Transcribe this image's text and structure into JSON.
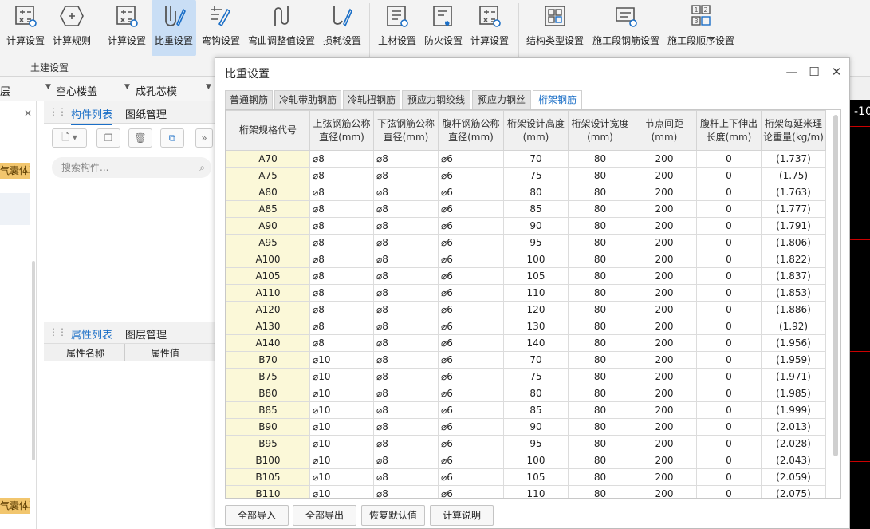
{
  "ribbon": {
    "groups": [
      {
        "label": "土建设置",
        "buttons": [
          {
            "label": "计算设置",
            "icon": "calc-settings-icon"
          },
          {
            "label": "计算规则",
            "icon": "calc-rules-icon"
          }
        ]
      },
      {
        "label": "",
        "buttons": [
          {
            "label": "计算设置",
            "icon": "calc-settings-icon"
          },
          {
            "label": "比重设置",
            "icon": "density-settings-icon",
            "active": true
          },
          {
            "label": "弯钩设置",
            "icon": "hook-settings-icon"
          },
          {
            "label": "弯曲调整值设置",
            "icon": "bend-adjust-icon"
          },
          {
            "label": "损耗设置",
            "icon": "loss-settings-icon"
          }
        ]
      },
      {
        "label": "",
        "buttons": [
          {
            "label": "主材设置",
            "icon": "main-material-icon"
          },
          {
            "label": "防火设置",
            "icon": "fireproof-icon"
          },
          {
            "label": "计算设置",
            "icon": "calc-settings-icon"
          }
        ]
      },
      {
        "label": "",
        "buttons": [
          {
            "label": "结构类型设置",
            "icon": "structure-type-icon"
          },
          {
            "label": "施工段钢筋设置",
            "icon": "segment-rebar-icon"
          },
          {
            "label": "施工段顺序设置",
            "icon": "segment-order-icon"
          }
        ]
      }
    ]
  },
  "filters": {
    "floor_partial": "层",
    "component_type": "空心楼盖",
    "component": "成孔芯模"
  },
  "left_panel": {
    "promo_label": "气囊体验",
    "close_glyph": "✕"
  },
  "component_panel": {
    "tab_list": "构件列表",
    "tab_drawings": "图纸管理",
    "search_placeholder": "搜索构件..."
  },
  "property_panel": {
    "tab_props": "属性列表",
    "tab_layers": "图层管理",
    "col_name": "属性名称",
    "col_value": "属性值"
  },
  "dialog": {
    "title": "比重设置",
    "tabs": [
      "普通钢筋",
      "冷轧带肋钢筋",
      "冷轧扭钢筋",
      "预应力钢绞线",
      "预应力钢丝",
      "桁架钢筋"
    ],
    "active_tab": 5,
    "columns": [
      "桁架规格代号",
      "上弦钢筋公称直径(mm)",
      "下弦钢筋公称直径(mm)",
      "腹杆钢筋公称直径(mm)",
      "桁架设计高度(mm)",
      "桁架设计宽度(mm)",
      "节点间距(mm)",
      "腹杆上下伸出长度(mm)",
      "桁架每延米理论重量(kg/m)"
    ],
    "rows": [
      [
        "A70",
        "⌀8",
        "⌀8",
        "⌀6",
        "70",
        "80",
        "200",
        "0",
        "(1.737)"
      ],
      [
        "A75",
        "⌀8",
        "⌀8",
        "⌀6",
        "75",
        "80",
        "200",
        "0",
        "(1.75)"
      ],
      [
        "A80",
        "⌀8",
        "⌀8",
        "⌀6",
        "80",
        "80",
        "200",
        "0",
        "(1.763)"
      ],
      [
        "A85",
        "⌀8",
        "⌀8",
        "⌀6",
        "85",
        "80",
        "200",
        "0",
        "(1.777)"
      ],
      [
        "A90",
        "⌀8",
        "⌀8",
        "⌀6",
        "90",
        "80",
        "200",
        "0",
        "(1.791)"
      ],
      [
        "A95",
        "⌀8",
        "⌀8",
        "⌀6",
        "95",
        "80",
        "200",
        "0",
        "(1.806)"
      ],
      [
        "A100",
        "⌀8",
        "⌀8",
        "⌀6",
        "100",
        "80",
        "200",
        "0",
        "(1.822)"
      ],
      [
        "A105",
        "⌀8",
        "⌀8",
        "⌀6",
        "105",
        "80",
        "200",
        "0",
        "(1.837)"
      ],
      [
        "A110",
        "⌀8",
        "⌀8",
        "⌀6",
        "110",
        "80",
        "200",
        "0",
        "(1.853)"
      ],
      [
        "A120",
        "⌀8",
        "⌀8",
        "⌀6",
        "120",
        "80",
        "200",
        "0",
        "(1.886)"
      ],
      [
        "A130",
        "⌀8",
        "⌀8",
        "⌀6",
        "130",
        "80",
        "200",
        "0",
        "(1.92)"
      ],
      [
        "A140",
        "⌀8",
        "⌀8",
        "⌀6",
        "140",
        "80",
        "200",
        "0",
        "(1.956)"
      ],
      [
        "B70",
        "⌀10",
        "⌀8",
        "⌀6",
        "70",
        "80",
        "200",
        "0",
        "(1.959)"
      ],
      [
        "B75",
        "⌀10",
        "⌀8",
        "⌀6",
        "75",
        "80",
        "200",
        "0",
        "(1.971)"
      ],
      [
        "B80",
        "⌀10",
        "⌀8",
        "⌀6",
        "80",
        "80",
        "200",
        "0",
        "(1.985)"
      ],
      [
        "B85",
        "⌀10",
        "⌀8",
        "⌀6",
        "85",
        "80",
        "200",
        "0",
        "(1.999)"
      ],
      [
        "B90",
        "⌀10",
        "⌀8",
        "⌀6",
        "90",
        "80",
        "200",
        "0",
        "(2.013)"
      ],
      [
        "B95",
        "⌀10",
        "⌀8",
        "⌀6",
        "95",
        "80",
        "200",
        "0",
        "(2.028)"
      ],
      [
        "B100",
        "⌀10",
        "⌀8",
        "⌀6",
        "100",
        "80",
        "200",
        "0",
        "(2.043)"
      ],
      [
        "B105",
        "⌀10",
        "⌀8",
        "⌀6",
        "105",
        "80",
        "200",
        "0",
        "(2.059)"
      ],
      [
        "B110",
        "⌀10",
        "⌀8",
        "⌀6",
        "110",
        "80",
        "200",
        "0",
        "(2.075)"
      ]
    ],
    "buttons": {
      "import_all": "全部导入",
      "export_all": "全部导出",
      "restore_defaults": "恢复默认值",
      "calc_note": "计算说明"
    }
  },
  "canvas": {
    "label": "-10"
  },
  "colors": {
    "accent": "#1b6fc7",
    "active_button_bg": "#c9def5",
    "code_cell_bg": "#fbf8d8",
    "promo_bg": "#f2c66e",
    "canvas_bg": "#000000",
    "canvas_line": "#cc0000"
  }
}
